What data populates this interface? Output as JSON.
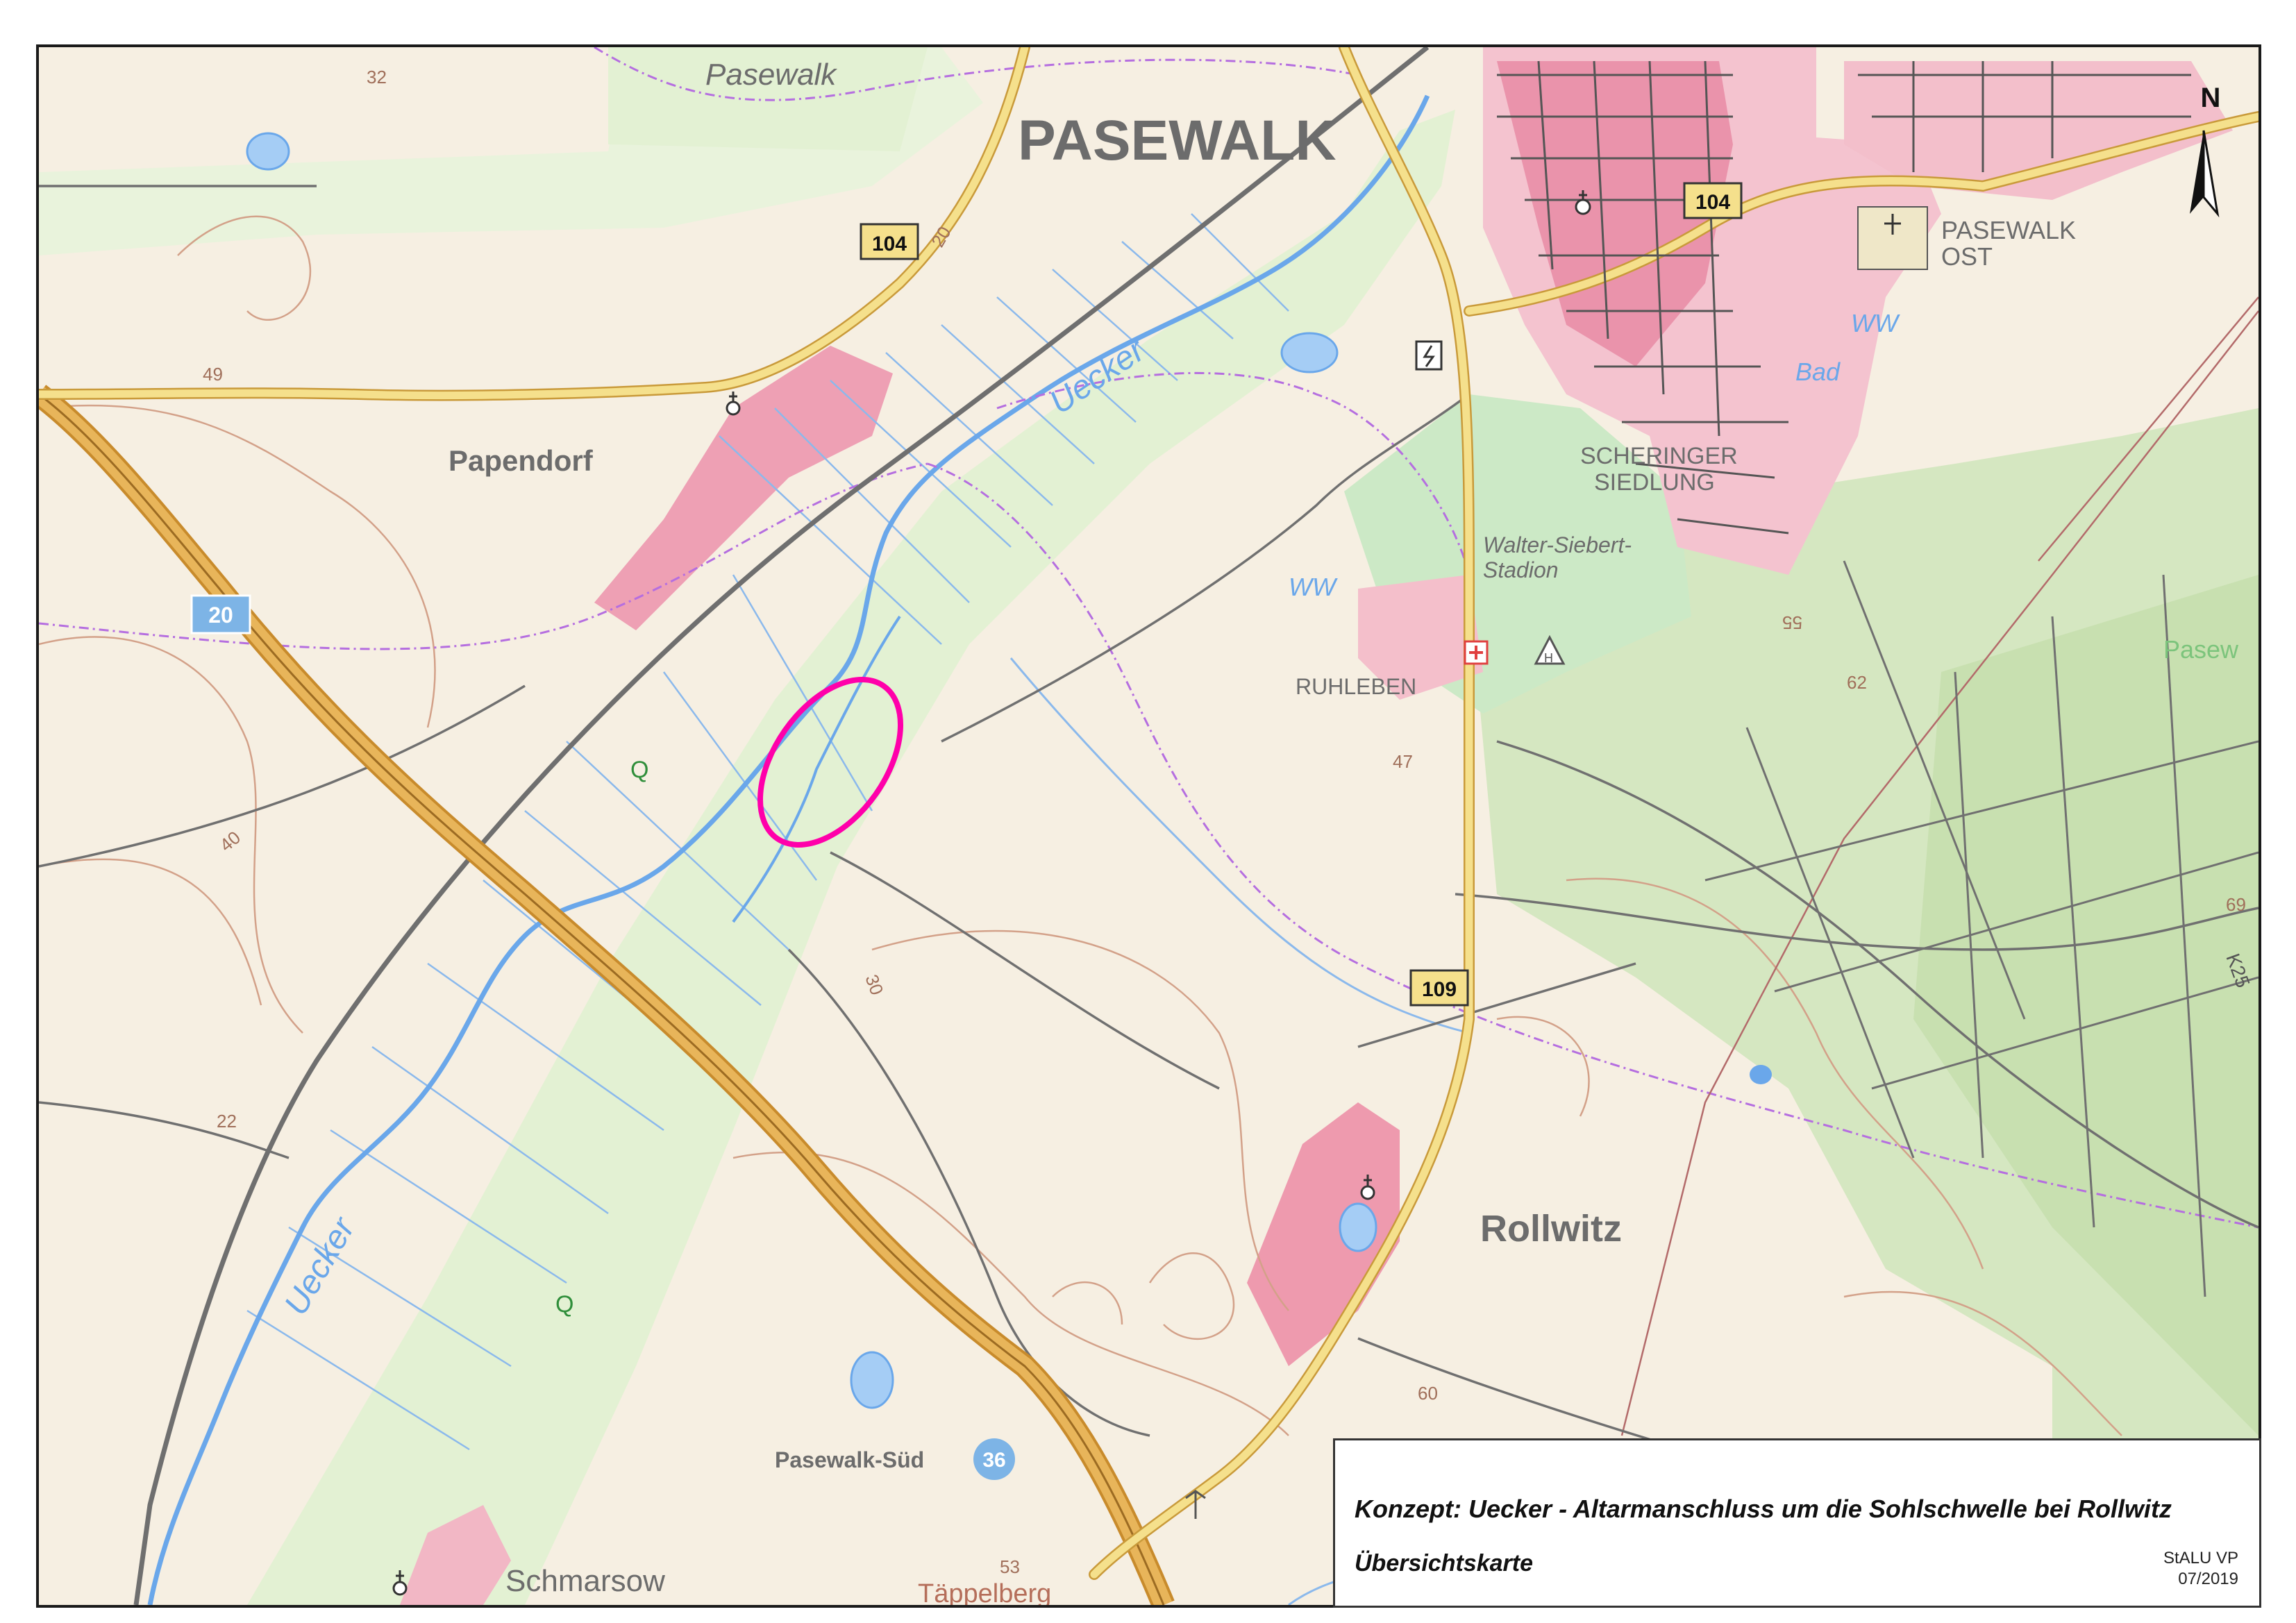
{
  "map": {
    "places": {
      "pasewalk": "PASEWALK",
      "pasewalk_top": "Pasewalk",
      "papendorf": "Papendorf",
      "scheringer_1": "SCHERINGER",
      "scheringer_2": "SIEDLUNG",
      "stadion_1": "Walter-Siebert-",
      "stadion_2": "Stadion",
      "ruhleben": "RUHLEBEN",
      "pasewalk_ost_1": "PASEWALK",
      "pasewalk_ost_2": "OST",
      "rollwitz": "Rollwitz",
      "schmarsow": "Schmarsow",
      "pasewalk_sued": "Pasewalk-Süd",
      "taeppelberg": "Täppelberg",
      "pasew_right": "Pasew",
      "bad": "Bad"
    },
    "water": {
      "uecker_north": "Uecker",
      "uecker_south": "Uecker",
      "ww_1": "WW",
      "ww_2": "WW"
    },
    "roads": {
      "b104_west": "104",
      "b104_east": "104",
      "b109": "109",
      "a20": "20",
      "exit_36": "36",
      "k25": "K25"
    },
    "elevations": {
      "e32": "32",
      "e49": "49",
      "e20": "20",
      "e40": "40",
      "e22": "22",
      "e30": "30",
      "e47": "47",
      "e55": "55",
      "e62": "62",
      "e69": "69",
      "e60": "60",
      "e53": "53"
    },
    "symbols": {
      "spring_1": "Q",
      "spring_2": "Q",
      "hospital": "H"
    },
    "north_arrow_label": "N"
  },
  "legend": {
    "title": "Konzept: Uecker - Altarmanschluss um die Sohlschwelle bei Rollwitz",
    "subtitle": "Übersichtskarte",
    "organization": "StALU VP",
    "date": "07/2019"
  },
  "colors": {
    "field": "#f6efe2",
    "meadow": "#e6f2d6",
    "forest": "#d6e8c2",
    "urban": "#ee9aae",
    "urban_light": "#f7cdd6",
    "water": "#6aa7ea",
    "motorway": "#e3a94a",
    "road_yellow": "#f3df86",
    "railway": "#7a7a7a",
    "contour": "#c98f72",
    "boundary": "#b56ee0",
    "study_area": "#ff00aa"
  }
}
